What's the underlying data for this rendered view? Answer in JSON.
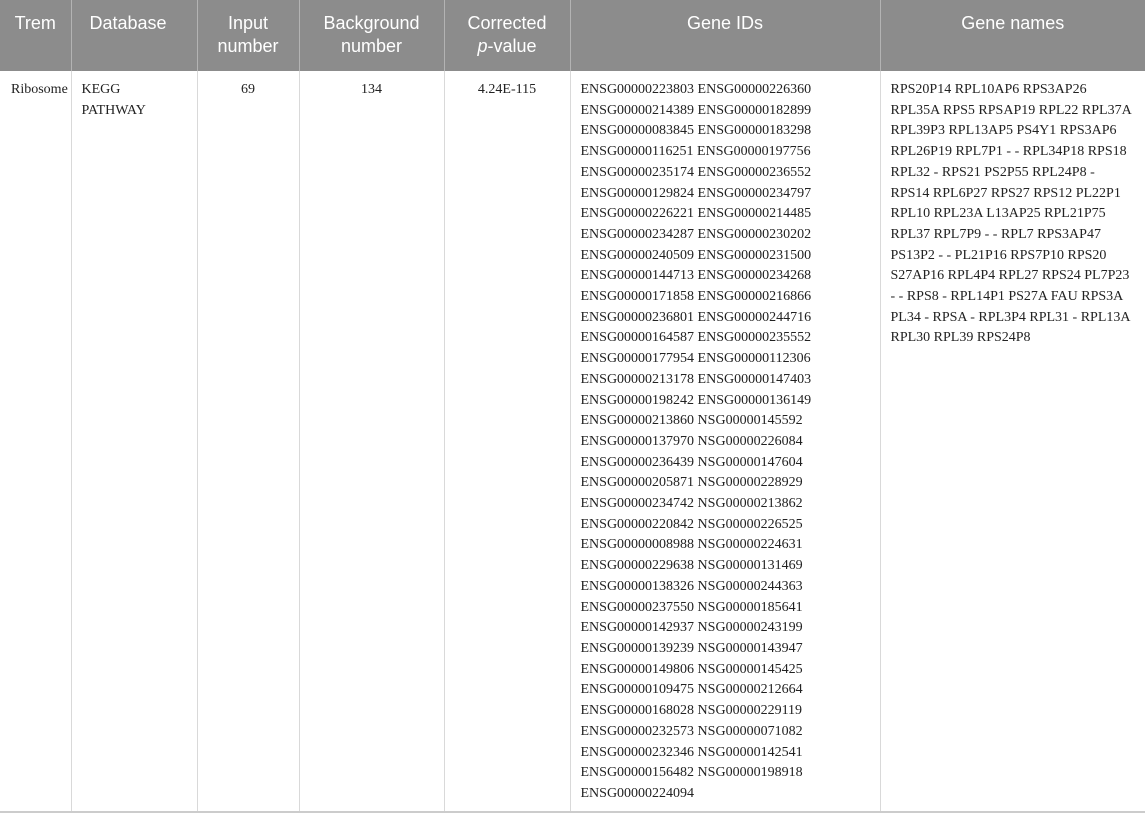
{
  "header": {
    "col1": "Trem",
    "col2": "Database",
    "col3_line1": "Input",
    "col3_line2": "number",
    "col4_line1": "Background",
    "col4_line2": "number",
    "col5_line1": "Corrected",
    "col5_italic": "p",
    "col5_rest": "-value",
    "col6": "Gene IDs",
    "col7": "Gene names"
  },
  "row": {
    "term": "Ribosome",
    "database_line1": "KEGG",
    "database_line2": "PATHWAY",
    "input_number": "69",
    "background_number": "134",
    "corrected_p": "4.24E-115",
    "gene_ids": [
      "ENSG00000223803 ENSG00000226360",
      "ENSG00000214389 ENSG00000182899",
      "ENSG00000083845 ENSG00000183298",
      "ENSG00000116251 ENSG00000197756",
      "ENSG00000235174 ENSG00000236552",
      "ENSG00000129824 ENSG00000234797",
      "ENSG00000226221 ENSG00000214485",
      "ENSG00000234287 ENSG00000230202",
      "ENSG00000240509 ENSG00000231500",
      "ENSG00000144713 ENSG00000234268",
      "ENSG00000171858 ENSG00000216866",
      "ENSG00000236801 ENSG00000244716",
      "ENSG00000164587 ENSG00000235552",
      "ENSG00000177954 ENSG00000112306",
      "ENSG00000213178 ENSG00000147403",
      "ENSG00000198242 ENSG00000136149",
      "ENSG00000213860 NSG00000145592",
      "ENSG00000137970 NSG00000226084",
      "ENSG00000236439 NSG00000147604",
      "ENSG00000205871 NSG00000228929",
      "ENSG00000234742 NSG00000213862",
      "ENSG00000220842 NSG00000226525",
      "ENSG00000008988 NSG00000224631",
      "ENSG00000229638 NSG00000131469",
      "ENSG00000138326 NSG00000244363",
      "ENSG00000237550 NSG00000185641",
      "ENSG00000142937 NSG00000243199",
      "ENSG00000139239 NSG00000143947",
      "ENSG00000149806 NSG00000145425",
      "ENSG00000109475 NSG00000212664",
      "ENSG00000168028 NSG00000229119",
      "ENSG00000232573 NSG00000071082",
      "ENSG00000232346 NSG00000142541",
      "ENSG00000156482 NSG00000198918",
      "ENSG00000224094"
    ],
    "gene_names": "RPS20P14 RPL10AP6 RPS3AP26 RPL35A RPS5 RPSAP19 RPL22 RPL37A RPL39P3 RPL13AP5 PS4Y1 RPS3AP6 RPL26P19 RPL7P1 - - RPL34P18 RPS18 RPL32 - RPS21 PS2P55 RPL24P8 - RPS14 RPL6P27 RPS27 RPS12 PL22P1 RPL10 RPL23A L13AP25 RPL21P75 RPL37 RPL7P9 - - RPL7 RPS3AP47 PS13P2 - - PL21P16 RPS7P10 RPS20 S27AP16 RPL4P4 RPL27 RPS24 PL7P23 - - RPS8 - RPL14P1 PS27A FAU RPS3A PL34 - RPSA - RPL3P4 RPL31 - RPL13A RPL30 RPL39 RPS24P8"
  }
}
